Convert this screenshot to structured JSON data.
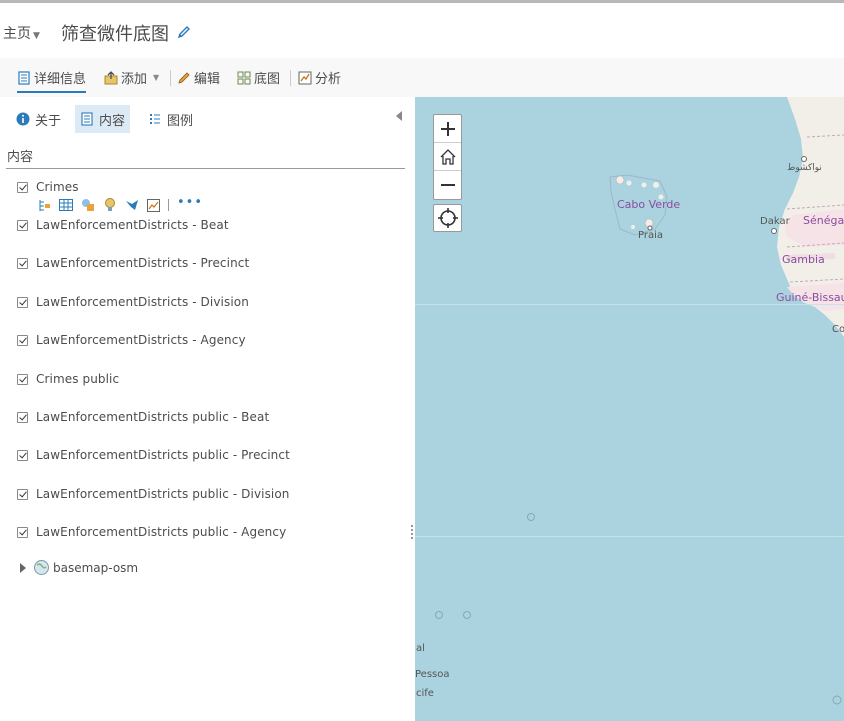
{
  "header": {
    "home_label": "主页",
    "map_title": "筛查微件底图"
  },
  "toolbar": {
    "details": "详细信息",
    "add": "添加",
    "edit": "编辑",
    "basemap": "底图",
    "analysis": "分析"
  },
  "panel": {
    "tabs": [
      {
        "label": "关于"
      },
      {
        "label": "内容"
      },
      {
        "label": "图例"
      }
    ],
    "section_title": "内容",
    "layers": [
      {
        "label": "Crimes",
        "checked": true
      },
      {
        "label": "LawEnforcementDistricts - Beat",
        "checked": true
      },
      {
        "label": "LawEnforcementDistricts - Precinct",
        "checked": true
      },
      {
        "label": "LawEnforcementDistricts - Division",
        "checked": true
      },
      {
        "label": "LawEnforcementDistricts - Agency",
        "checked": true
      },
      {
        "label": "Crimes public",
        "checked": true
      },
      {
        "label": "LawEnforcementDistricts public - Beat",
        "checked": true
      },
      {
        "label": "LawEnforcementDistricts public - Precinct",
        "checked": true
      },
      {
        "label": "LawEnforcementDistricts public - Division",
        "checked": true
      },
      {
        "label": "LawEnforcementDistricts public - Agency",
        "checked": true
      }
    ],
    "basemap_layer": "basemap-osm",
    "layer_tool_icons": [
      "show-item-details-icon",
      "show-table-icon",
      "change-style-icon",
      "filter-icon",
      "perform-analysis-icon",
      "show-legend-icon",
      "more-options-icon"
    ]
  },
  "map": {
    "labels": {
      "cabo_verde": "Cabo Verde",
      "praia": "Praia",
      "dakar": "Dakar",
      "senegal": "Sénégal",
      "gambia": "Gambia",
      "guinea_bissau": "Guiné-Bissau",
      "nouakchott": "نواكشوط",
      "co": "Co",
      "al": "al",
      "pessoa": "Pessoa",
      "recife": "cife"
    },
    "colors": {
      "ocean": "#aad3df",
      "land": "#f2efe9",
      "label_purple": "#8b4c9e"
    }
  }
}
